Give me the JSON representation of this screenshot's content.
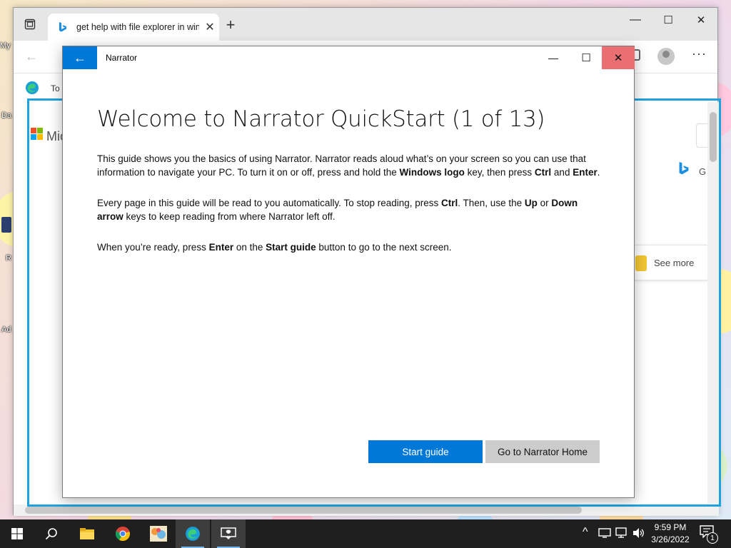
{
  "desktop": {
    "icon_labels": [
      "My",
      "Da",
      "R",
      "Ad"
    ]
  },
  "browser": {
    "tab": {
      "title": "get help with file explorer in wind",
      "close_glyph": "✕"
    },
    "new_tab_glyph": "+",
    "window_controls": {
      "minimize": "—",
      "maximize": "☐",
      "close": "✕"
    },
    "toolbar": {
      "back_glyph": "←",
      "more_glyph": "···"
    },
    "page": {
      "to_text": "To",
      "ms_text": "Mic",
      "bing_g_text": "G",
      "see_more_label": "See more"
    }
  },
  "narrator": {
    "window_title": "Narrator",
    "back_glyph": "←",
    "controls": {
      "minimize": "—",
      "maximize": "☐",
      "close": "✕"
    },
    "heading": "Welcome to Narrator QuickStart (1 of 13)",
    "paragraphs": {
      "p1": {
        "t1": "This guide shows you the basics of using Narrator. Narrator reads aloud what’s on your screen so you can use that information to navigate your PC. To turn it on or off, press and hold the ",
        "b1": "Windows logo",
        "t2": " key, then press ",
        "b2": "Ctrl",
        "t3": " and ",
        "b3": "Enter",
        "t4": "."
      },
      "p2": {
        "t1": "Every page in this guide will be read to you automatically. To stop reading, press ",
        "b1": "Ctrl",
        "t2": ". Then, use the ",
        "b2": "Up",
        "t3": " or ",
        "b3": "Down arrow",
        "t4": " keys to keep reading from where Narrator left off."
      },
      "p3": {
        "t1": "When you’re ready, press ",
        "b1": "Enter",
        "t2": " on the ",
        "b2": "Start guide",
        "t3": " button to go to the next screen."
      }
    },
    "buttons": {
      "start": "Start guide",
      "home": "Go to Narrator Home"
    }
  },
  "taskbar": {
    "clock_time": "9:59 PM",
    "clock_date": "3/26/2022",
    "notification_count": "1",
    "tray_chevron": "^"
  },
  "colors": {
    "accent": "#0078d7",
    "focus_highlight": "#1fa2e0",
    "close_hover": "#e96f72",
    "taskbar": "#1f1f1f"
  }
}
